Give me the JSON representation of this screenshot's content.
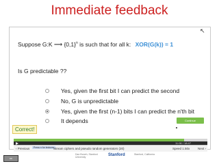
{
  "title": "Immediate feedback",
  "question": {
    "line1_part1": "Suppose  G:K ⟶ {0,1}",
    "line1_sup": "n",
    "line1_part2": "  is such that for all k:",
    "line1_highlight": "XOR(G(k)) = 1",
    "line2": "Is G predictable ??"
  },
  "options": [
    {
      "label": "Yes, given the first bit I can predict the second",
      "selected": false
    },
    {
      "label": "No, G is unpredictable",
      "selected": false
    },
    {
      "label": "Yes, given the first (n-1) bits I can predict the n'th bit",
      "selected": true
    },
    {
      "label": "It depends",
      "selected": false
    }
  ],
  "feedback": "Correct!",
  "continue_label": "Continue",
  "player": {
    "progress_fraction": 0.88,
    "time": "11:06 / 18:47"
  },
  "nav": {
    "prev_label": "‹ Previous",
    "chip_label": "Press n for lectures",
    "lecture_title": "Stream ciphers and pseudo random generators (20)",
    "speed_label": "Speed  1.50x",
    "next_label": "Next ›"
  },
  "footer": {
    "license": "cc",
    "text_left": "Dan Boneh, Stanford University",
    "logo_text": "Stanford",
    "text_right": "Stanford, California"
  },
  "colors": {
    "title": "#cc1f1f",
    "highlight": "#3b8fd6",
    "correct_bg": "#fff7c9",
    "accent_green": "#7bbf4a"
  }
}
